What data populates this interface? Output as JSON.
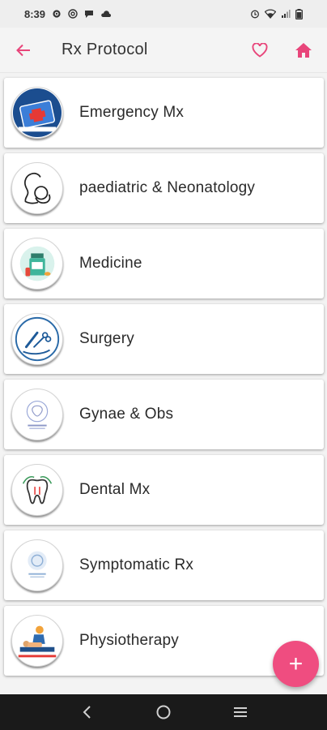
{
  "status_bar": {
    "time": "8:39",
    "left_icons": [
      "gear-icon",
      "at-sign-icon",
      "chat-icon",
      "cloud-icon"
    ],
    "right_icons": [
      "alarm-icon",
      "wifi-icon",
      "signal-icon",
      "battery-icon"
    ]
  },
  "app_bar": {
    "title": "Rx Protocol",
    "back_icon": "arrow-left-icon",
    "favorite_icon": "heart-icon",
    "home_icon": "home-icon",
    "accent_color": "#e8457a"
  },
  "categories": [
    {
      "label": "Emergency Mx",
      "icon": "emergency-kit-icon"
    },
    {
      "label": "paediatric & Neonatology",
      "icon": "mother-baby-icon"
    },
    {
      "label": "Medicine",
      "icon": "medicine-bottle-icon"
    },
    {
      "label": "Surgery",
      "icon": "surgery-tools-icon"
    },
    {
      "label": "Gynae & Obs",
      "icon": "gynae-logo-icon"
    },
    {
      "label": "Dental Mx",
      "icon": "tooth-icon"
    },
    {
      "label": "Symptomatic Rx",
      "icon": "symptomatic-logo-icon"
    },
    {
      "label": "Physiotherapy",
      "icon": "physiotherapy-icon"
    }
  ],
  "fab": {
    "label": "+",
    "color": "#ef4d80"
  },
  "nav_bar": {
    "icons": [
      "back-nav-icon",
      "home-nav-icon",
      "recents-nav-icon"
    ]
  }
}
